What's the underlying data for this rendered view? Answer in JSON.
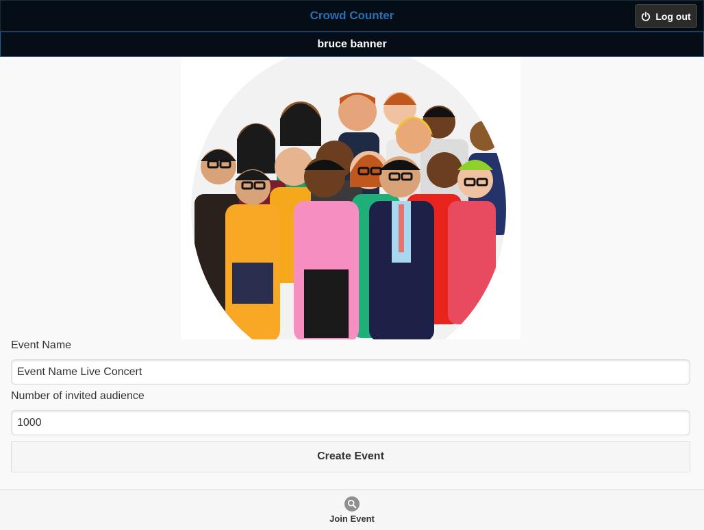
{
  "header": {
    "title": "Crowd Counter",
    "logout_label": "Log out",
    "logout_icon": "power-icon"
  },
  "user": {
    "name": "bruce banner"
  },
  "hero": {
    "image": "crowd-illustration"
  },
  "form": {
    "event_name_label": "Event Name",
    "event_name_value": "Event Name Live Concert",
    "audience_label": "Number of invited audience",
    "audience_value": "1000",
    "create_label": "Create Event"
  },
  "footer": {
    "join_label": "Join Event",
    "join_icon": "search-icon"
  },
  "colors": {
    "header_bg": "#050e16",
    "title_blue": "#2a70b3",
    "border_blue": "#235d8f",
    "page_bg": "#f9f9f9"
  }
}
